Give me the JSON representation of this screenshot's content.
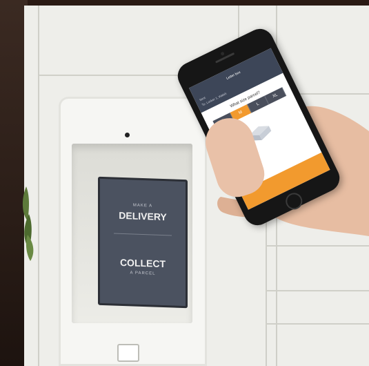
{
  "kiosk_screen": {
    "line1_small": "MAKE A",
    "line1_big": "DELIVERY",
    "line2_big": "COLLECT",
    "line2_small": "A PARCEL"
  },
  "phone": {
    "status": "",
    "header_title": "Letter box",
    "rows": [
      "Sent",
      "To: Locker 1, Walsh"
    ],
    "question": "What size parcel?",
    "sizes": [
      "S",
      "M",
      "L",
      "XL"
    ],
    "selected_size": "M",
    "caption": "",
    "cta": ""
  },
  "colors": {
    "accent": "#f29a2e",
    "phone_header": "#3d4658",
    "kiosk_screen": "#4b5260",
    "locker": "#eeeeea"
  }
}
